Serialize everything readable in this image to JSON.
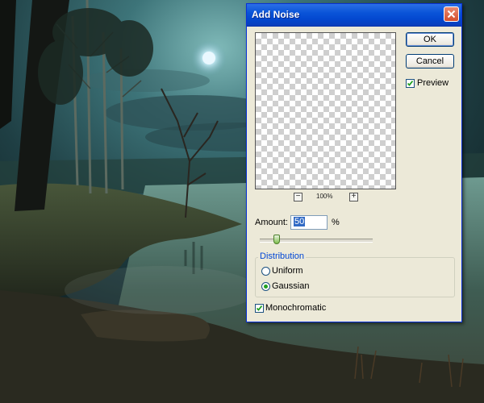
{
  "dialog": {
    "title": "Add Noise",
    "ok_label": "OK",
    "cancel_label": "Cancel",
    "preview_label": "Preview",
    "preview_checked": true,
    "zoom_level": "100%",
    "zoom_out_symbol": "−",
    "zoom_in_symbol": "+",
    "amount_label": "Amount:",
    "amount_value": "50",
    "amount_unit": "%",
    "distribution_title": "Distribution",
    "distribution_options": [
      {
        "label": "Uniform",
        "selected": false
      },
      {
        "label": "Gaussian",
        "selected": true
      }
    ],
    "monochromatic_label": "Monochromatic",
    "monochromatic_checked": true
  },
  "icons": {
    "close": "close-icon",
    "check": "checkmark-icon"
  },
  "colors": {
    "titlebar": "#0a54d8",
    "dialog_bg": "#ece9d8",
    "group_title": "#0046d5",
    "close_button": "#d44e2c"
  }
}
